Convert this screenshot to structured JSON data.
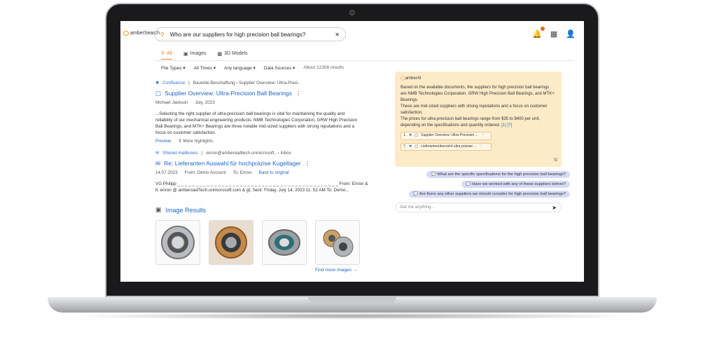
{
  "app": {
    "logo": "amberSearch"
  },
  "search": {
    "query": "Who are our suppliers for high precision ball bearings?"
  },
  "tabs": [
    {
      "label": "All"
    },
    {
      "label": "Images"
    },
    {
      "label": "3D Models"
    }
  ],
  "filters": {
    "file_types": "File Types",
    "all_times": "All Times",
    "any_language": "Any language",
    "data_sources": "Data Sources",
    "result_count": "About 12356 results"
  },
  "results": [
    {
      "source": "Confluence",
      "path": "Bauteile-Beschaffung › Supplier Overview: Ultra-Preci..",
      "title": "Supplier Overview: Ultra-Precision Ball Bearings",
      "author": "Michael Jackson",
      "date": "July, 2023",
      "snippet": "...Selecting the right supplier of ultra-precision ball bearings is vital for maintaining the quality and reliability of our mechanical engineering products. NMB Technologies Corporation, GRW High Precision Ball Bearings, and MTK+ Bearings are three notable mid-sized suppliers with strong reputations and a focus on customer satisfaction.",
      "preview": "Preview",
      "more": "More highlights"
    },
    {
      "source": "Shared mailboxes",
      "path": "enron@amberoadtech.onmicrosoft.. › Inbox",
      "title": "Re: Lieferanten Auswahl für hochpräzise Kugellager",
      "date": "14.07.2023",
      "from_label": "From:",
      "from": "Demo Account",
      "to_label": "To:",
      "to": "Enron",
      "back": "Back to original",
      "line1": "VG Philipp _ _ _ _ _ _ _ _ _ _ _ _ _ _ _ _ _ _ _ _ _ _ _ _ _ _ _ _ _ _ _ _ _ _ _ _ _ _ _ _ _ _ _ _ From: Enron &",
      "line2": "lt; enron @ amberoadTech.onmicrosoft.com & gt; Sent: Friday, July 14, 2023 11: 52 AM To: Demo..."
    }
  ],
  "images": {
    "title": "Image Results",
    "more": "Find more images →"
  },
  "ai": {
    "brand": "amberAI",
    "answer1": "Based on the available documents, the suppliers for high precision ball bearings are NMB Technologies Corporation, GRW High Precision Ball Bearings, and MTK+ Bearings.",
    "answer2": "These are mid-sized suppliers with strong reputations and a focus on customer satisfaction.",
    "answer3": "The prices for ultra-precision ball bearings range from $35 to $400 per unit, depending on the specifications and quantity ordered.",
    "refs": "[1] [?]",
    "citations": [
      {
        "num": "1.",
        "label": "Supplier Overview: Ultra-Precision ..."
      },
      {
        "num": "7.",
        "label": "Lieferantenübersicht ultra präzise ..."
      }
    ],
    "suggestions": [
      "What are the specific specifications for the high precision ball bearings?",
      "Have we worked with any of these suppliers before?",
      "Are there any other suppliers we should consider for high precision ball bearings?"
    ],
    "ask_placeholder": "Ask me anything..."
  },
  "colors": {
    "accent": "#e4862a",
    "link": "#1f63c9",
    "ai_bg": "#fdebc8"
  }
}
